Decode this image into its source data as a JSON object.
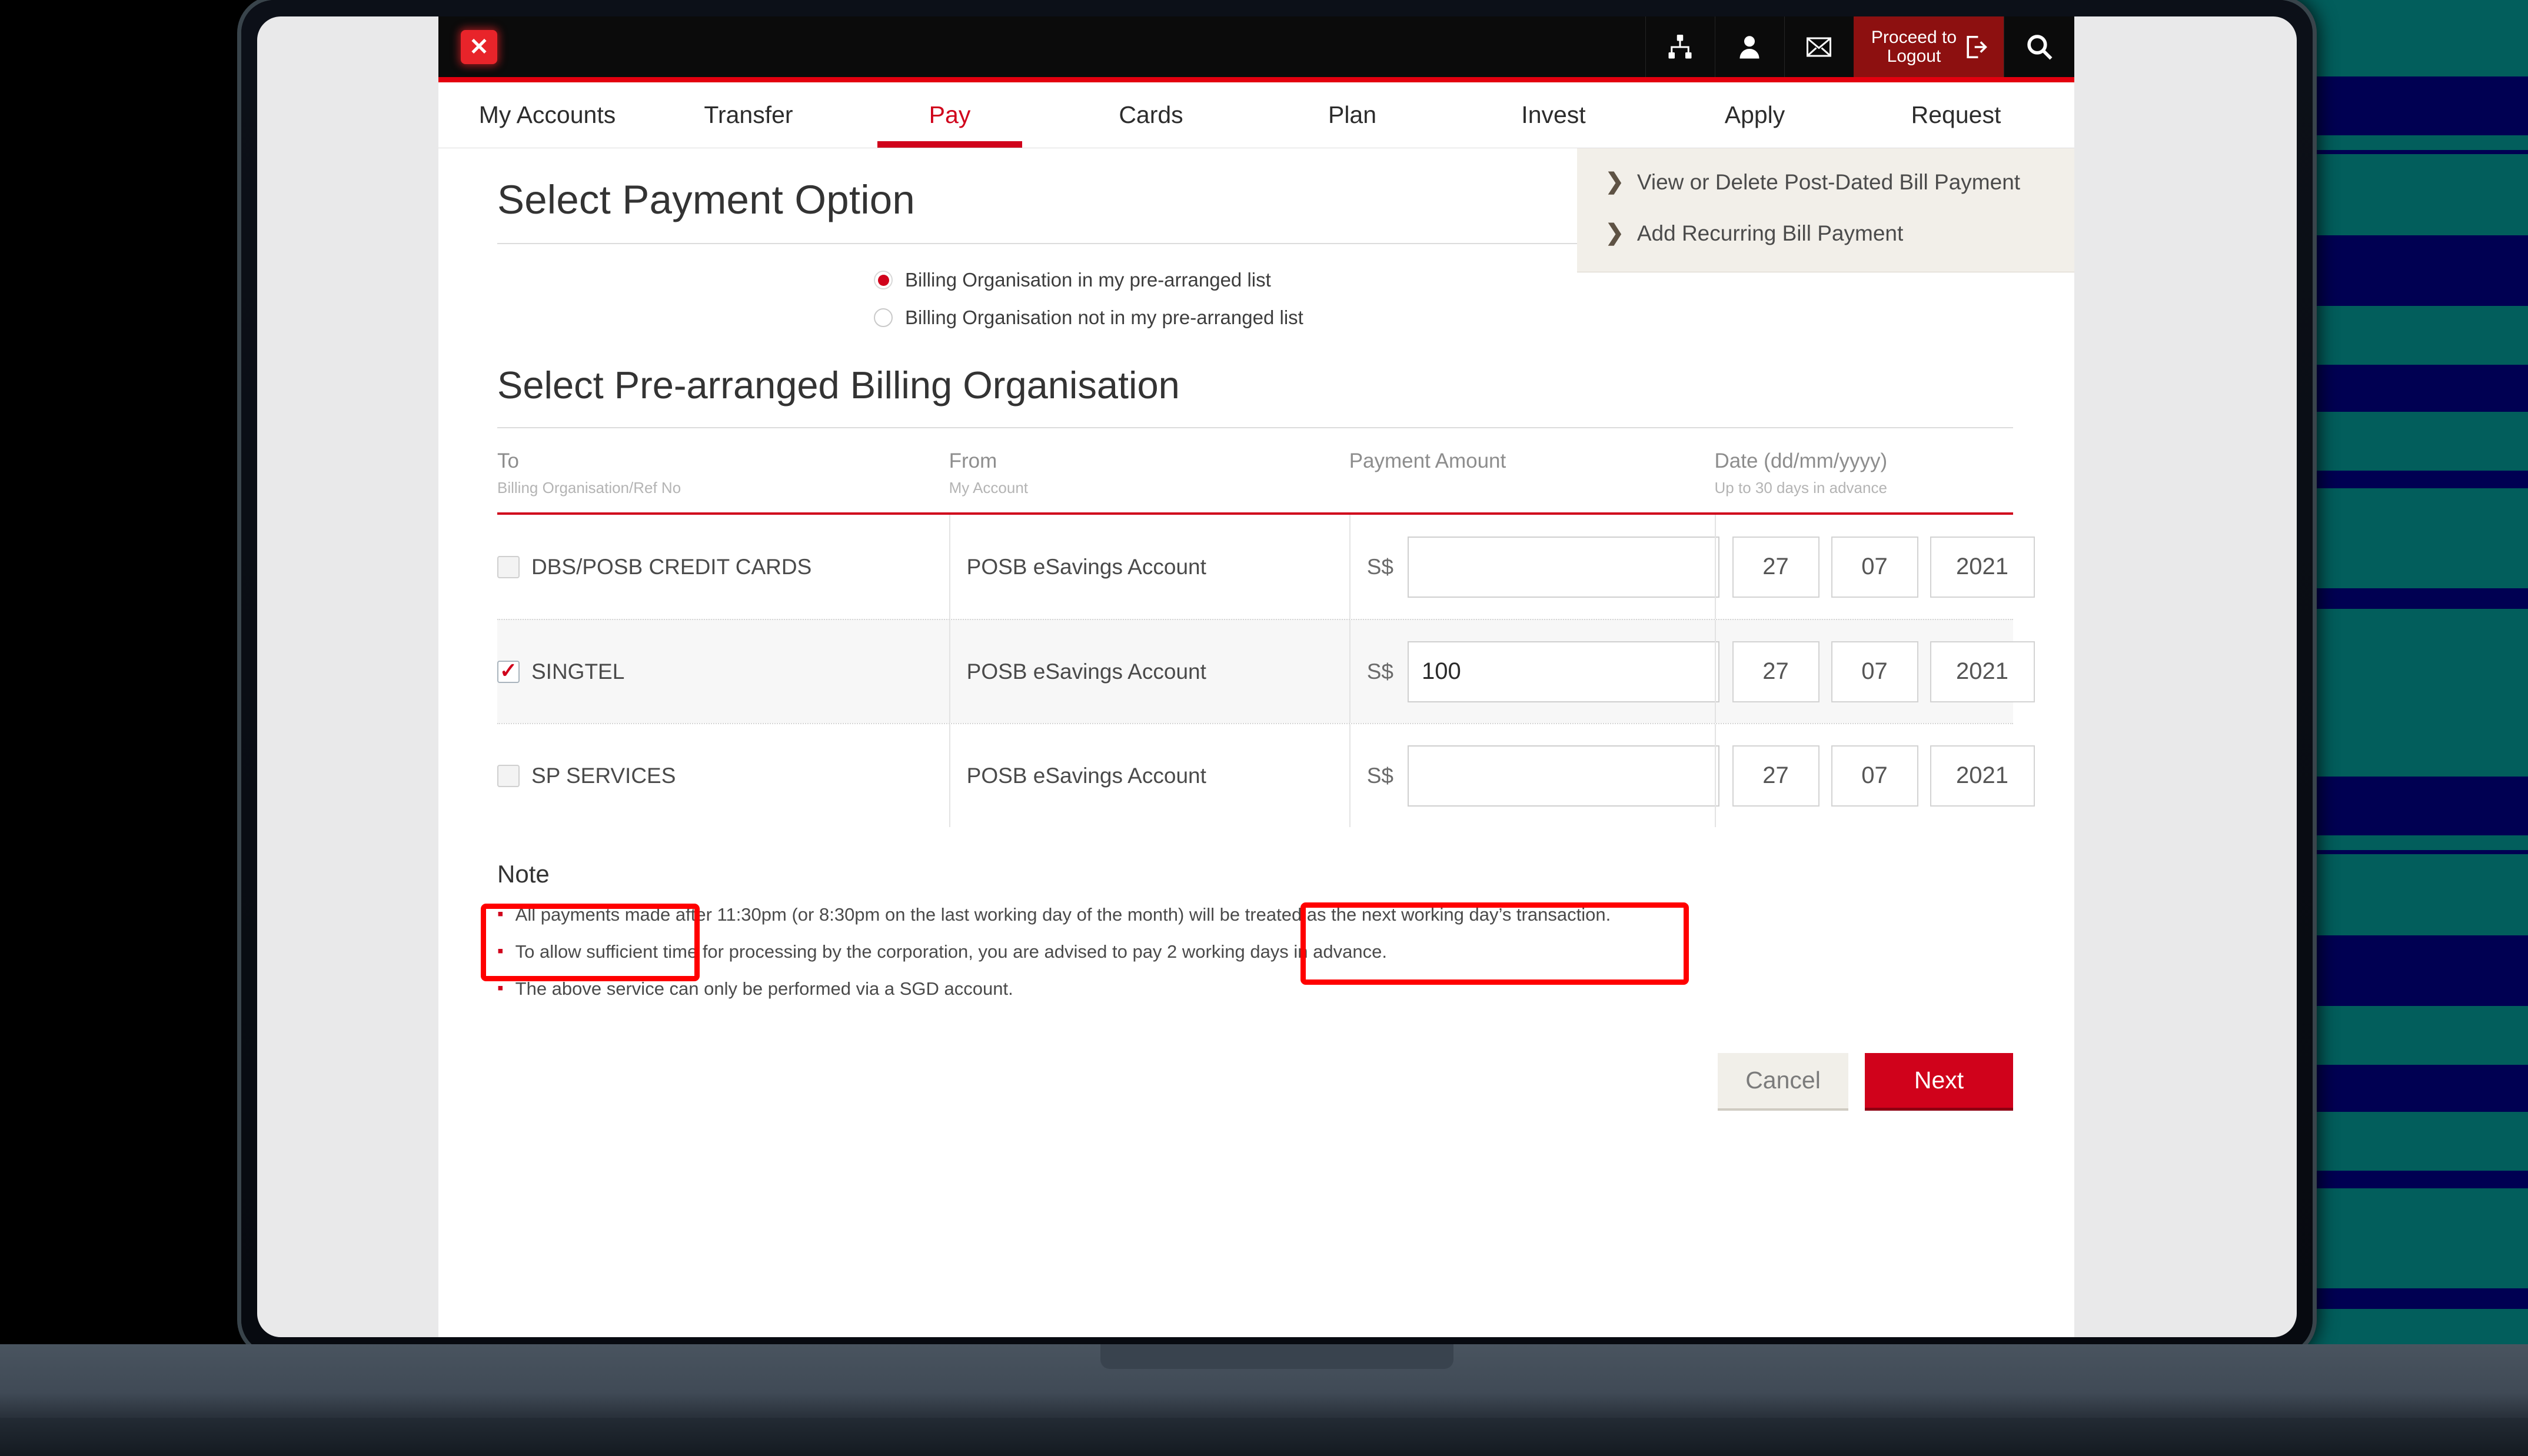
{
  "topbar": {
    "close_icon": "close-icon",
    "icons": [
      {
        "name": "sitemap-icon"
      },
      {
        "name": "user-icon"
      },
      {
        "name": "envelope-icon"
      }
    ],
    "logout_label": "Proceed to\nLogout",
    "logout_icon": "logout-icon",
    "search_icon": "search-icon"
  },
  "nav": {
    "items": [
      {
        "label": "My Accounts",
        "active": false
      },
      {
        "label": "Transfer",
        "active": false
      },
      {
        "label": "Pay",
        "active": true
      },
      {
        "label": "Cards",
        "active": false
      },
      {
        "label": "Plan",
        "active": false
      },
      {
        "label": "Invest",
        "active": false
      },
      {
        "label": "Apply",
        "active": false
      },
      {
        "label": "Request",
        "active": false
      }
    ]
  },
  "side_panel": {
    "links": [
      {
        "chevron": "❯",
        "label": "View or Delete Post-Dated Bill Payment"
      },
      {
        "chevron": "❯",
        "label": "Add Recurring Bill Payment"
      }
    ]
  },
  "payment_option": {
    "title": "Select Payment Option",
    "radios": [
      {
        "label": "Billing Organisation in my pre-arranged list",
        "selected": true
      },
      {
        "label": "Billing Organisation not in my pre-arranged list",
        "selected": false
      }
    ]
  },
  "billing": {
    "title": "Select Pre-arranged Billing Organisation",
    "headers": [
      {
        "primary": "To",
        "secondary": "Billing Organisation/Ref No"
      },
      {
        "primary": "From",
        "secondary": "My Account"
      },
      {
        "primary": "Payment Amount",
        "secondary": ""
      },
      {
        "primary": "Date (dd/mm/yyyy)",
        "secondary": "Up to 30 days in advance"
      }
    ],
    "rows": [
      {
        "organisation": "DBS/POSB CREDIT CARDS",
        "checked": false,
        "account": "POSB eSavings Account",
        "currency": "S$",
        "amount": "",
        "amount_placeholder": "",
        "day": "27",
        "month": "07",
        "year": "2021"
      },
      {
        "organisation": "SINGTEL",
        "checked": true,
        "account": "POSB eSavings Account",
        "currency": "S$",
        "amount": "100",
        "amount_placeholder": "",
        "day": "27",
        "month": "07",
        "year": "2021"
      },
      {
        "organisation": "SP SERVICES",
        "checked": false,
        "account": "POSB eSavings Account",
        "currency": "S$",
        "amount": "",
        "amount_placeholder": "",
        "day": "27",
        "month": "07",
        "year": "2021"
      }
    ]
  },
  "note": {
    "title": "Note",
    "bullet": "▪",
    "items": [
      "All payments made after 11:30pm (or 8:30pm on the last working day of the month) will be treated as the next working day’s transaction.",
      "To allow sufficient time for processing by the corporation, you are advised to pay 2 working days in advance.",
      "The above service can only be performed via a SGD account."
    ]
  },
  "actions": {
    "cancel_label": "Cancel",
    "next_label": "Next"
  },
  "colors": {
    "brand_red": "#d0021b",
    "topbar_black": "#0b0b0b",
    "logout_red": "#8d1010",
    "annotation_red": "#ff0000",
    "panel_beige": "#f2efe9",
    "stripe_teal": "#025e5c",
    "stripe_navy": "#000052"
  }
}
